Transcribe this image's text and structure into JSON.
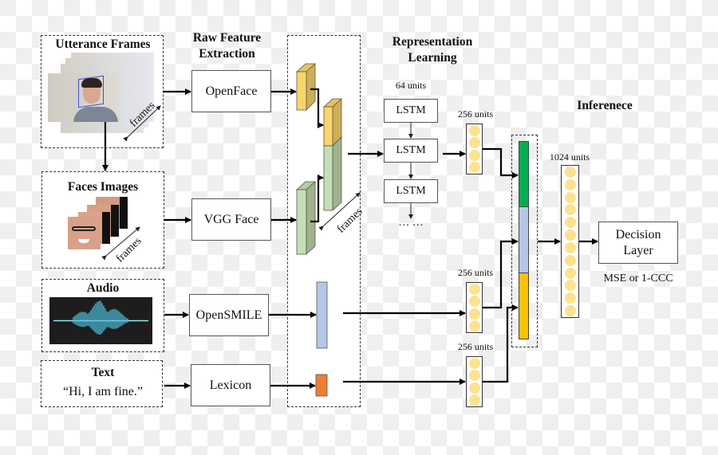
{
  "diagram": {
    "inputs": {
      "utterance": {
        "title": "Utterance Frames",
        "frames_label": "frames"
      },
      "faces": {
        "title": "Faces Images",
        "frames_label": "frames"
      },
      "audio": {
        "title": "Audio"
      },
      "text": {
        "title": "Text",
        "sample": "“Hi, I am fine.”"
      }
    },
    "sections": {
      "raw_feature": "Raw Feature\nExtraction",
      "representation": "Representation\nLearning",
      "inference": "Inferenece"
    },
    "extractors": {
      "openface": "OpenFace",
      "vggface": "VGG Face",
      "opensmile": "OpenSMILE",
      "lexicon": "Lexicon"
    },
    "feature_frames_label": "frames",
    "lstm": {
      "units_label": "64 units",
      "cells": [
        "LSTM",
        "LSTM",
        "LSTM"
      ],
      "ellipsis": "… …"
    },
    "dense": {
      "visual_units": "256 units",
      "audio_units": "256 units",
      "text_units": "256 units",
      "fusion_units": "1024 units",
      "small_circles": 4,
      "fusion_circles": 12
    },
    "decision": {
      "label": "Decision\nLayer",
      "loss": "MSE or 1-CCC"
    },
    "colors": {
      "openface_feature": "#fdd567",
      "vgg_feature": "#c5dfb4",
      "audio_feature": "#b4c7e7",
      "text_feature": "#ed7d31",
      "concat_visual": "#00b050",
      "concat_audio": "#b4c7e7",
      "concat_text": "#ffc000",
      "unit_circle": "#fde28e"
    }
  }
}
